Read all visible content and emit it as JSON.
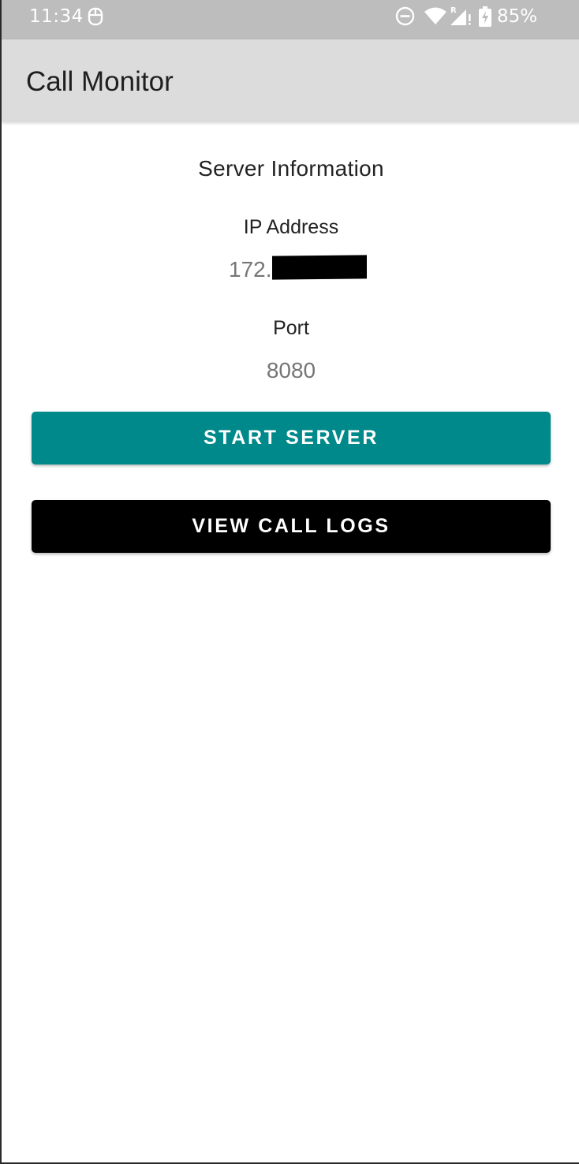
{
  "status_bar": {
    "time": "11:34",
    "battery": "85%",
    "icons": [
      "notification-icon",
      "do-not-disturb-icon",
      "wifi-icon",
      "cellular-signal-icon",
      "battery-charging-icon"
    ],
    "signal_roaming_mark": "R"
  },
  "app_bar": {
    "title": "Call Monitor"
  },
  "server_info": {
    "title": "Server Information",
    "ip_label": "IP Address",
    "ip_value_visible": "172.",
    "port_label": "Port",
    "port_value": "8080"
  },
  "actions": {
    "start_server_label": "START SERVER",
    "view_call_logs_label": "VIEW CALL LOGS"
  },
  "colors": {
    "status_bar_bg": "#bdbdbd",
    "app_bar_bg": "#dcdcdc",
    "start_button_bg": "#00898a",
    "logs_button_bg": "#000000",
    "value_text": "#757575"
  }
}
